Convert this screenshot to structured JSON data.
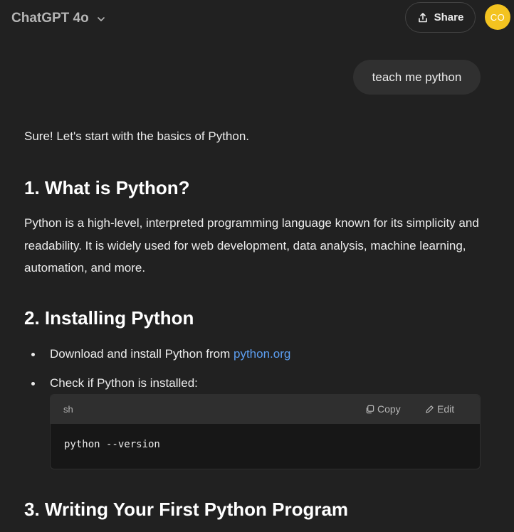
{
  "header": {
    "model_name": "ChatGPT 4o",
    "share_label": "Share",
    "avatar_initials": "CO"
  },
  "user_message": "teach me python",
  "assistant": {
    "intro": "Sure! Let's start with the basics of Python.",
    "section1_title": "1. What is Python?",
    "section1_body": "Python is a high-level, interpreted programming language known for its simplicity and readability. It is widely used for web development, data analysis, machine learning, automation, and more.",
    "section2_title": "2. Installing Python",
    "bullet1_text": "Download and install Python from ",
    "bullet1_link": "python.org",
    "bullet2_text": "Check if Python is installed:",
    "code": {
      "language": "sh",
      "copy_label": "Copy",
      "edit_label": "Edit",
      "content": "python --version"
    },
    "section3_title": "3. Writing Your First Python Program"
  },
  "colors": {
    "background": "#212121",
    "user_bubble": "#303030",
    "code_header": "#2f2f2f",
    "code_body": "#171717",
    "link": "#5c9ef0",
    "avatar": "#f3c320"
  }
}
